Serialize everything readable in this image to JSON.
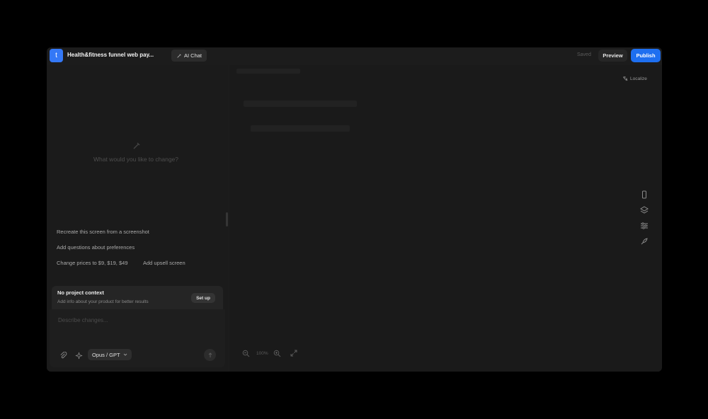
{
  "header": {
    "app_logo_letter": "t",
    "project_title": "Health&fitness funnel web pay...",
    "ai_chat_tab": "AI Chat",
    "saved_status": "Saved",
    "preview_label": "Preview",
    "publish_label": "Publish"
  },
  "chat": {
    "empty_prompt": "What would you like to change?",
    "suggestions": [
      "Recreate this screen from a screenshot",
      "Add questions about preferences",
      "Change prices to $9, $19, $49",
      "Add upsell screen"
    ],
    "context": {
      "title": "No project context",
      "description": "Add info about your product for better results",
      "setup_label": "Set up"
    },
    "composer": {
      "placeholder": "Describe changes...",
      "model_label": "Opus / GPT"
    }
  },
  "canvas": {
    "localize_label": "Localize",
    "zoom_level": "100%",
    "tools": [
      "phone-icon",
      "layers-icon",
      "sliders-icon",
      "rocket-icon"
    ]
  },
  "colors": {
    "accent": "#1e6ff0",
    "logo": "#3478f6",
    "window_bg": "#1c1c1c",
    "page_bg": "#000000"
  }
}
